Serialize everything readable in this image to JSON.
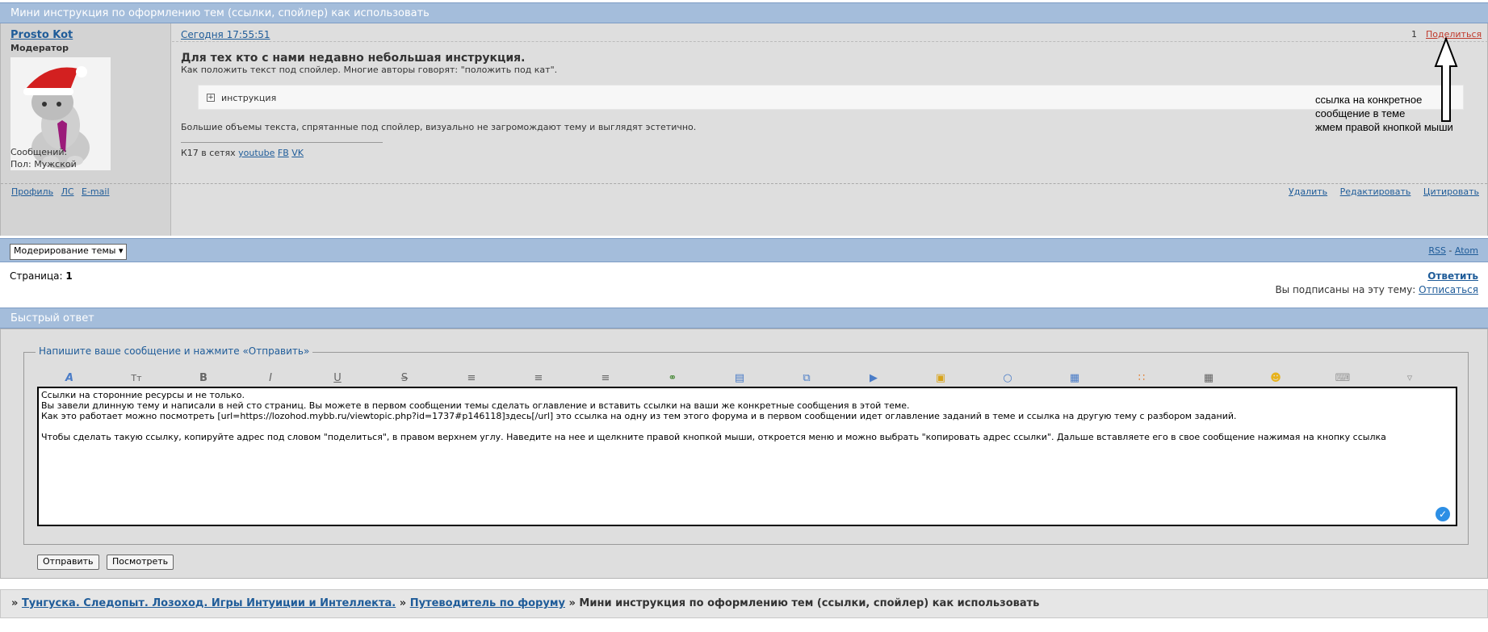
{
  "topic_title": "Мини инструкция по оформлению тем (ссылки, спойлер) как использовать",
  "post": {
    "author": "Prosto Kot",
    "role": "Модератор",
    "messages_label": "Сообщений:",
    "gender_label": "Пол: Мужской",
    "date": "Сегодня 17:55:51",
    "number": "1",
    "share": "Поделиться",
    "heading": "Для тех кто с нами недавно небольшая инструкция.",
    "paragraph1": "Как положить текст под спойлер. Многие авторы говорят: \"положить под кат\".",
    "spoiler_label": "инструкция",
    "paragraph2": "Большие объемы текста, спрятанные под спойлер, визуально не загромождают тему и выглядят эстетично.",
    "signature_prefix": "К17 в сетях ",
    "signature_links": [
      "youtube",
      "FB",
      "VK"
    ],
    "footer_left": [
      "Профиль",
      "ЛС",
      "E-mail"
    ],
    "footer_right": [
      "Удалить",
      "Редактировать",
      "Цитировать"
    ]
  },
  "annotation": {
    "line1": "ссылка на конкретное",
    "line2": "сообщение в теме",
    "line3": "жмем правой кнопкой мыши"
  },
  "moderation": {
    "select_value": "Модерирование темы",
    "rss": "RSS",
    "separator": " - ",
    "atom": "Atom"
  },
  "pagination": {
    "label": "Страница: ",
    "current": "1",
    "reply": "Ответить",
    "subscribed_text": "Вы подписаны на эту тему: ",
    "unsubscribe": "Отписаться"
  },
  "quick_reply": {
    "header": "Быстрый ответ",
    "legend": "Напишите ваше сообщение и нажмите «Отправить»",
    "toolbar_icons": [
      "font-icon",
      "size-icon",
      "bold-icon",
      "italic-icon",
      "underline-icon",
      "strike-icon",
      "align-left-icon",
      "align-center-icon",
      "align-right-icon",
      "link-icon",
      "book-icon",
      "copy-icon",
      "video-icon",
      "lock-icon",
      "speech-icon",
      "image-icon",
      "color-icon",
      "table-icon",
      "smile-icon",
      "keyboard-icon",
      "more-icon"
    ],
    "editor_text": "Ссылки на сторонние ресурсы и не только.\nВы завели длинную тему и написали в ней сто страниц. Вы можете в первом сообщении темы сделать оглавление и вставить ссылки на ваши же конкретные сообщения в этой теме.\nКак это работает можно посмотреть [url=https://lozohod.mybb.ru/viewtopic.php?id=1737#p146118]здесь[/url] это ссылка на одну из тем этого форума и в первом сообщении идет оглавление заданий в теме и ссылка на другую тему с разбором заданий.\n\nЧтобы сделать такую ссылку, копируйте адрес под словом \"поделиться\", в правом верхнем углу. Наведите на нее и щелкните правой кнопкой мыши, откроется меню и можно выбрать \"копировать адрес ссылки\". Дальше вставляете его в свое сообщение нажимая на кнопку ссылка",
    "submit": "Отправить",
    "preview": "Посмотреть"
  },
  "breadcrumbs": {
    "sep": "»",
    "items": [
      "Тунгуска. Следопыт. Лозоход. Игры Интуиции и Интеллекта.",
      "Путеводитель по форуму"
    ],
    "current": "Мини инструкция по оформлению тем (ссылки, спойлер) как использовать"
  }
}
